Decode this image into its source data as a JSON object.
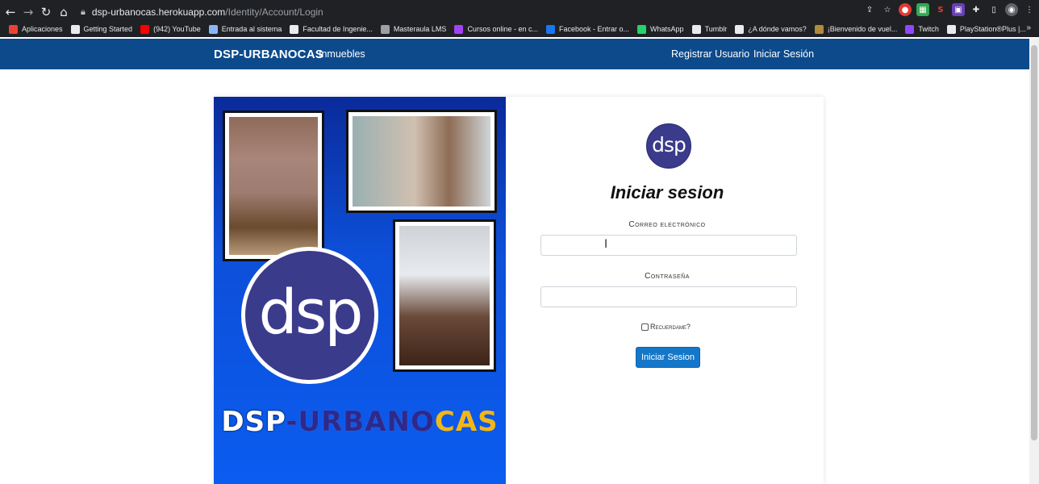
{
  "browser": {
    "url_host": "dsp-urbanocas.herokuapp.com",
    "url_path": "/Identity/Account/Login",
    "icons": [
      "back-icon",
      "forward-icon",
      "reload-icon",
      "home-icon",
      "lock-icon"
    ]
  },
  "bookmarks": [
    {
      "label": "Aplicaciones",
      "color": "#ea4335"
    },
    {
      "label": "Getting Started",
      "color": "#e8eaed"
    },
    {
      "label": "(942) YouTube",
      "color": "#ff0000"
    },
    {
      "label": "Entrada al sistema",
      "color": "#8ab4f8"
    },
    {
      "label": "Facultad de Ingenie...",
      "color": "#e8eaed"
    },
    {
      "label": "Masteraula LMS",
      "color": "#9aa0a6"
    },
    {
      "label": "Cursos online - en c...",
      "color": "#a142f4"
    },
    {
      "label": "Facebook - Entrar o...",
      "color": "#1877f2"
    },
    {
      "label": "WhatsApp",
      "color": "#25d366"
    },
    {
      "label": "Tumblr",
      "color": "#e8eaed"
    },
    {
      "label": "¿A dónde vamos?",
      "color": "#e8eaed"
    },
    {
      "label": "¡Bienvenido de vuel...",
      "color": "#b08a3e"
    },
    {
      "label": "Twitch",
      "color": "#9146ff"
    },
    {
      "label": "PlayStation®Plus |...",
      "color": "#e8eaed"
    }
  ],
  "bookmarks_more": "»",
  "site": {
    "brand": "DSP-URBANOCAS",
    "nav_inmuebles": "Inmuebles",
    "nav_register": "Registrar Usuario",
    "nav_login": "Iniciar Sesión",
    "nav_color": "#0c4a8c"
  },
  "promo": {
    "logo_text": "dsp",
    "title_part1": "DSP",
    "title_part2": "-URBANO",
    "title_part3": "CAS"
  },
  "form": {
    "logo_text": "dsp",
    "title": "Iniciar sesion",
    "email_label": "Correo electrónico",
    "email_value": "",
    "password_label": "Contraseña",
    "password_value": "",
    "remember_label": "Recuerdame?",
    "submit_label": "Iniciar Sesion",
    "accent_color": "#1477c9"
  }
}
